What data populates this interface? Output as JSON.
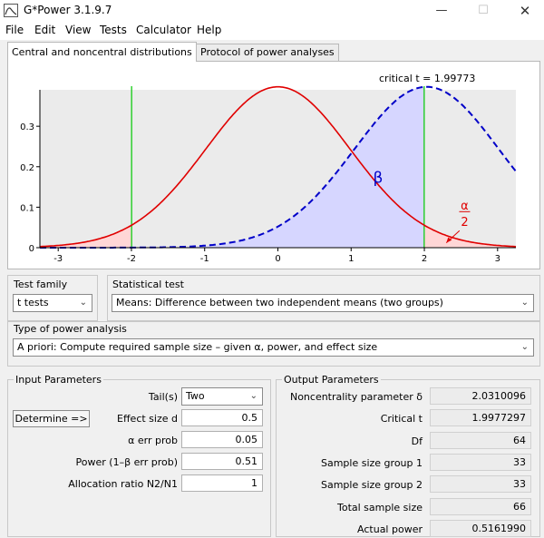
{
  "window": {
    "title": "G*Power 3.1.9.7"
  },
  "menu": [
    "File",
    "Edit",
    "View",
    "Tests",
    "Calculator",
    "Help"
  ],
  "tabs": [
    "Central and noncentral distributions",
    "Protocol of power analyses"
  ],
  "chart_data": {
    "type": "line",
    "annotation": "critical t = 1.99773",
    "critical_t": 1.99773,
    "noncentrality": 2.0310096,
    "df": 64,
    "xlim": [
      -3.25,
      3.25
    ],
    "ylim": [
      0,
      0.39
    ],
    "x_ticks": [
      "-3",
      "-2",
      "-1",
      "0",
      "1",
      "2",
      "3"
    ],
    "y_ticks": [
      "0",
      "0.1",
      "0.2",
      "0.3"
    ],
    "beta_label": "β",
    "alpha_num": "α",
    "alpha_den": "2",
    "colors": {
      "central": "#e00000",
      "noncentral": "#0000c8",
      "critical": "#00c800",
      "beta_fill": "#d6d6ff",
      "alpha_fill": "#ffd6d6"
    }
  },
  "test_family": {
    "label": "Test family",
    "value": "t tests"
  },
  "statistical_test": {
    "label": "Statistical test",
    "value": "Means: Difference between two independent means (two groups)"
  },
  "power_analysis": {
    "label": "Type of power analysis",
    "value": "A priori: Compute required sample size – given α, power, and effect size"
  },
  "input": {
    "title": "Input Parameters",
    "determine_label": "Determine =>",
    "tails_label": "Tail(s)",
    "tails_value": "Two",
    "effect_label": "Effect size d",
    "effect_value": "0.5",
    "alpha_label": "α err prob",
    "alpha_value": "0.05",
    "power_label": "Power (1–β err prob)",
    "power_value": "0.51",
    "ratio_label": "Allocation ratio N2/N1",
    "ratio_value": "1"
  },
  "output": {
    "title": "Output Parameters",
    "rows": [
      {
        "label": "Noncentrality parameter δ",
        "value": "2.0310096"
      },
      {
        "label": "Critical t",
        "value": "1.9977297"
      },
      {
        "label": "Df",
        "value": "64"
      },
      {
        "label": "Sample size group 1",
        "value": "33"
      },
      {
        "label": "Sample size group 2",
        "value": "33"
      },
      {
        "label": "Total sample size",
        "value": "66"
      },
      {
        "label": "Actual power",
        "value": "0.5161990"
      }
    ]
  }
}
